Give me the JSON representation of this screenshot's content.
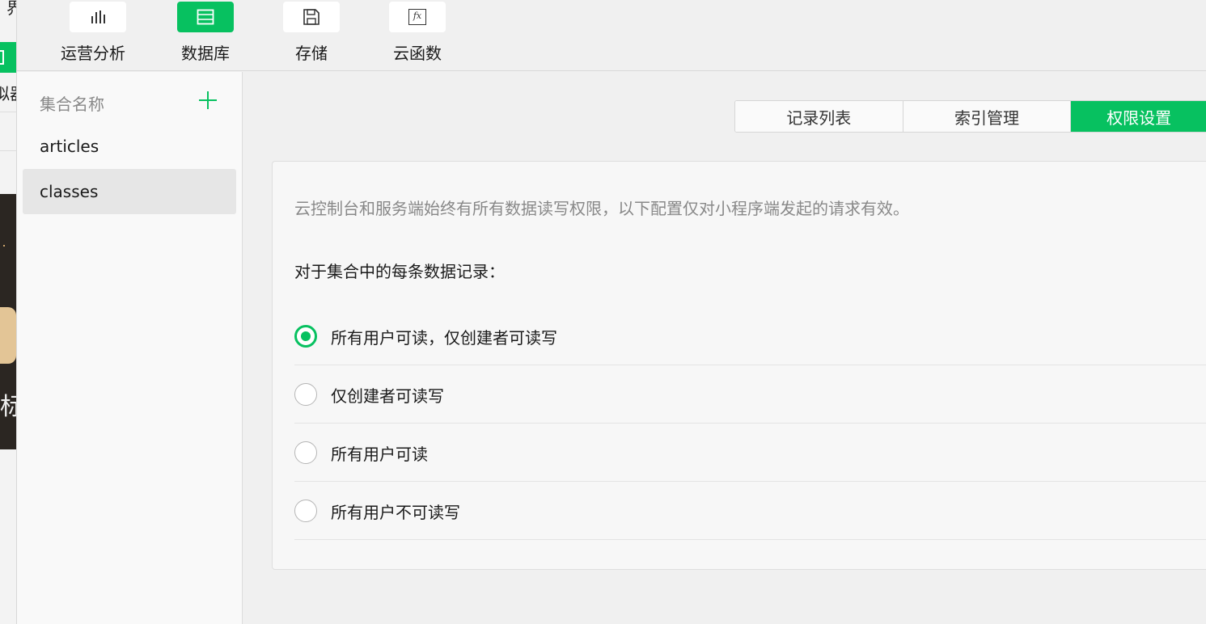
{
  "background": {
    "top_text": "界",
    "side_text": "拟器",
    "banner_char": "标"
  },
  "toolbar": {
    "items": [
      {
        "label": "运营分析",
        "icon": "bar-chart-icon",
        "active": false
      },
      {
        "label": "数据库",
        "icon": "database-icon",
        "active": true
      },
      {
        "label": "存储",
        "icon": "save-icon",
        "active": false
      },
      {
        "label": "云函数",
        "icon": "function-icon",
        "icon_text": "fx",
        "active": false
      }
    ]
  },
  "sidebar": {
    "header": "集合名称",
    "add_icon": "plus-icon",
    "collections": [
      {
        "name": "articles",
        "selected": false
      },
      {
        "name": "classes",
        "selected": true
      }
    ]
  },
  "tabs": [
    {
      "label": "记录列表",
      "active": false
    },
    {
      "label": "索引管理",
      "active": false
    },
    {
      "label": "权限设置",
      "active": true
    }
  ],
  "permissions": {
    "notice": "云控制台和服务端始终有所有数据读写权限，以下配置仅对小程序端发起的请求有效。",
    "subtitle": "对于集合中的每条数据记录：",
    "options": [
      {
        "label": "所有用户可读，仅创建者可读写",
        "checked": true
      },
      {
        "label": "仅创建者可读写",
        "checked": false
      },
      {
        "label": "所有用户可读",
        "checked": false
      },
      {
        "label": "所有用户不可读写",
        "checked": false
      }
    ]
  },
  "colors": {
    "accent": "#07c160",
    "muted_text": "#888888"
  }
}
